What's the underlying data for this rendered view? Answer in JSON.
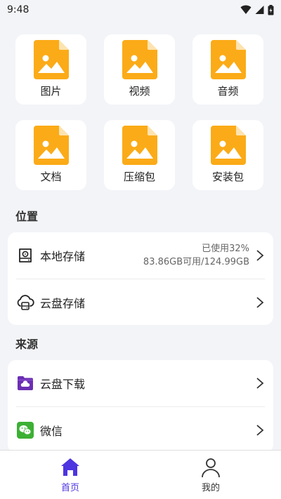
{
  "status_bar": {
    "time": "9:48"
  },
  "colors": {
    "accent": "#4d35e0",
    "file_icon": "#fbab18",
    "file_fold": "#fde3b0",
    "wechat": "#3cb034",
    "cloud_folder": "#6b2fb3"
  },
  "categories": [
    {
      "label": "图片",
      "icon": "image-file-icon"
    },
    {
      "label": "视频",
      "icon": "image-file-icon"
    },
    {
      "label": "音频",
      "icon": "image-file-icon"
    },
    {
      "label": "文档",
      "icon": "image-file-icon"
    },
    {
      "label": "压缩包",
      "icon": "image-file-icon"
    },
    {
      "label": "安装包",
      "icon": "image-file-icon"
    }
  ],
  "location": {
    "title": "位置",
    "local": {
      "label": "本地存储",
      "used": "已使用32%",
      "capacity": "83.86GB可用/124.99GB",
      "icon": "hard-drive-icon"
    },
    "cloud": {
      "label": "云盘存储",
      "icon": "cloud-storage-icon"
    }
  },
  "source": {
    "title": "来源",
    "download": {
      "label": "云盘下载",
      "icon": "cloud-folder-icon"
    },
    "wechat": {
      "label": "微信",
      "icon": "wechat-icon"
    }
  },
  "bottom_nav": {
    "home": {
      "label": "首页",
      "icon": "home-icon",
      "active": true
    },
    "mine": {
      "label": "我的",
      "icon": "user-icon",
      "active": false
    }
  }
}
